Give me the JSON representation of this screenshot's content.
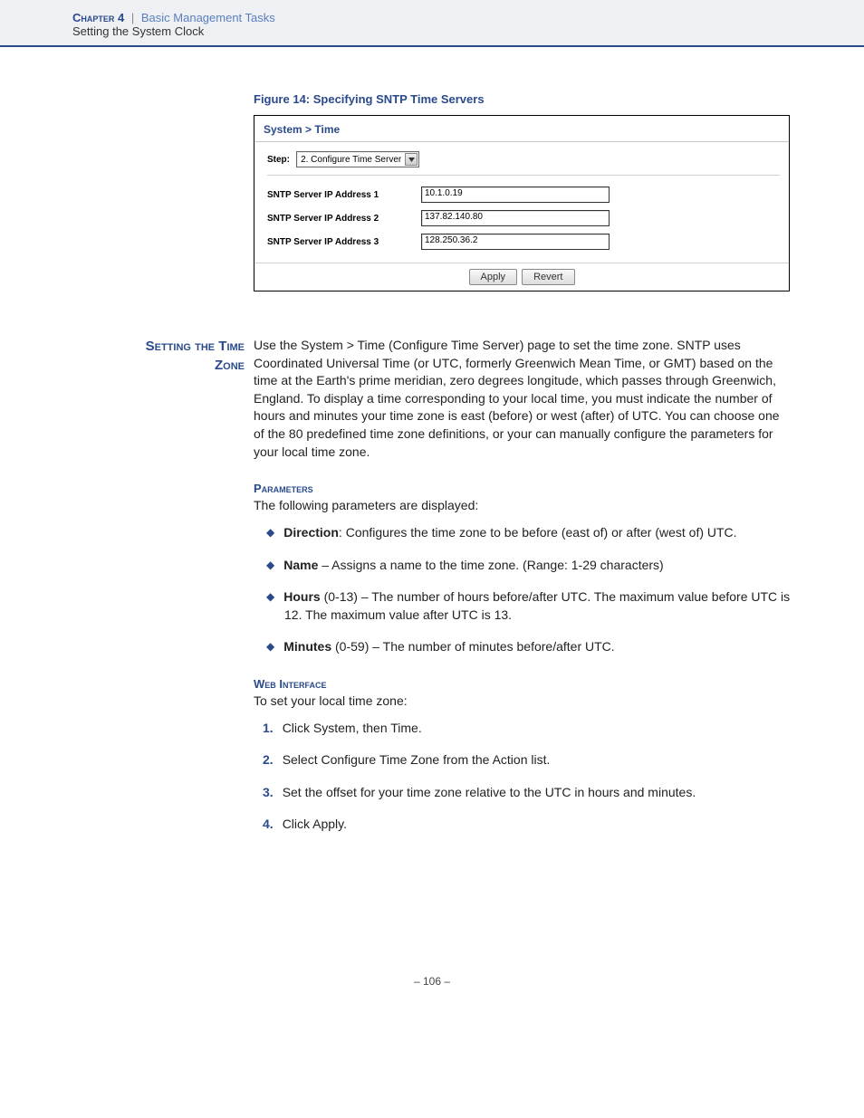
{
  "header": {
    "chapter": "Chapter 4",
    "breadcrumb": "Basic Management Tasks",
    "subtitle": "Setting the System Clock"
  },
  "figure": {
    "caption": "Figure 14:  Specifying SNTP Time Servers"
  },
  "screenshot": {
    "title": "System > Time",
    "step_label": "Step:",
    "step_value": "2. Configure Time Server",
    "fields": [
      {
        "label": "SNTP Server IP Address 1",
        "value": "10.1.0.19"
      },
      {
        "label": "SNTP Server IP Address 2",
        "value": "137.82.140.80"
      },
      {
        "label": "SNTP Server IP Address 3",
        "value": "128.250.36.2"
      }
    ],
    "apply": "Apply",
    "revert": "Revert"
  },
  "section": {
    "label_line1": "Setting the Time",
    "label_line2": "Zone",
    "intro": "Use the System > Time (Configure Time Server) page to set the time zone. SNTP uses Coordinated Universal Time (or UTC, formerly Greenwich Mean Time, or GMT) based on the time at the Earth's prime meridian, zero degrees longitude, which passes through Greenwich, England. To display a time corresponding to your local time, you must indicate the number of hours and minutes your time zone is east (before) or west (after) of UTC. You can choose one of the 80 predefined time zone definitions, or your can manually configure the parameters for your local time zone."
  },
  "parameters": {
    "heading": "Parameters",
    "lead": "The following parameters are displayed:",
    "items": [
      {
        "name": "Direction",
        "sep": ": ",
        "desc": "Configures the time zone to be before (east of) or after (west of) UTC."
      },
      {
        "name": "Name",
        "sep": " – ",
        "desc": "Assigns a name to the time zone. (Range: 1-29 characters)"
      },
      {
        "name": "Hours",
        "sep": " ",
        "desc": "(0-13) – The number of hours before/after UTC. The maximum value before UTC is 12. The maximum value after UTC is 13."
      },
      {
        "name": "Minutes",
        "sep": " ",
        "desc": "(0-59) – The number of minutes before/after UTC."
      }
    ]
  },
  "webinterface": {
    "heading": "Web Interface",
    "lead": "To set your local time zone:",
    "steps": [
      "Click System, then Time.",
      "Select Configure Time Zone from the Action list.",
      "Set the offset for your time zone relative to the UTC in hours and minutes.",
      "Click Apply."
    ]
  },
  "page": "–  106  –"
}
